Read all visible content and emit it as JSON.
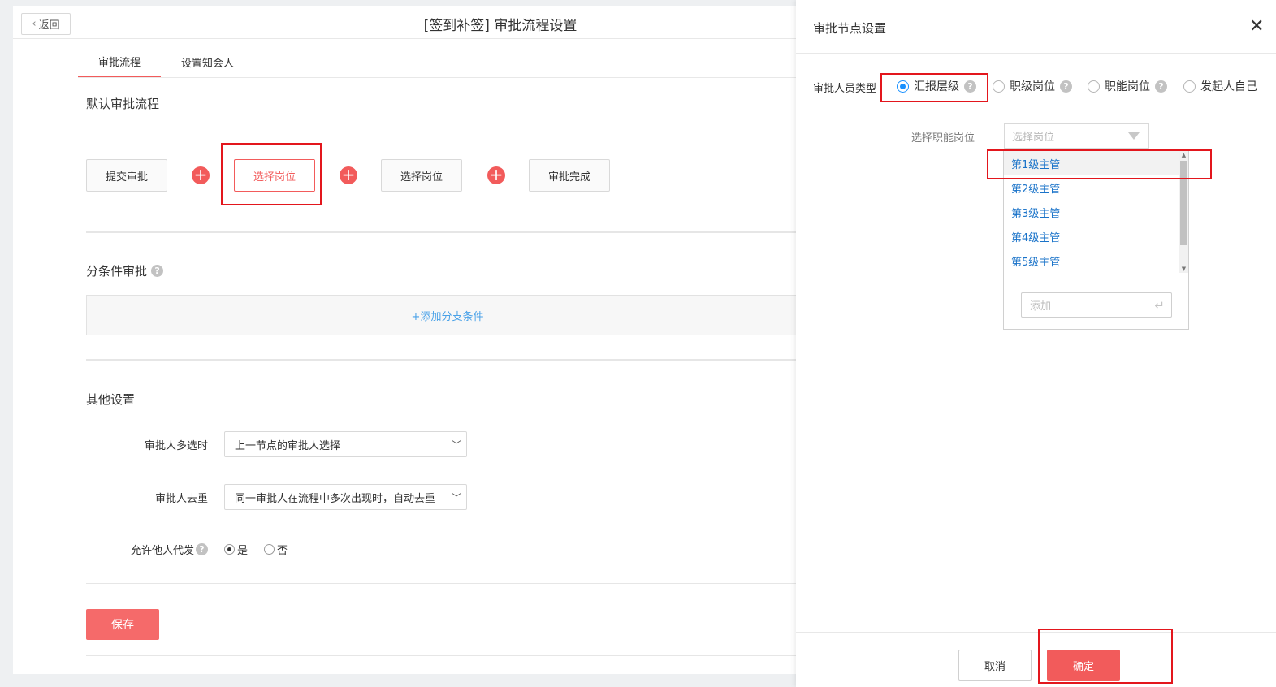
{
  "header": {
    "back_label": "返回",
    "title": "[签到补签] 审批流程设置"
  },
  "tabs": [
    {
      "label": "审批流程",
      "active": true
    },
    {
      "label": "设置知会人",
      "active": false
    }
  ],
  "default_flow": {
    "title": "默认审批流程",
    "nodes": [
      "提交审批",
      "选择岗位",
      "选择岗位",
      "审批完成"
    ],
    "add_icon": "plus-circle-icon"
  },
  "branch": {
    "title": "分条件审批",
    "help_icon": "?",
    "add_label": "+添加分支条件"
  },
  "other_settings": {
    "title": "其他设置",
    "multi_select": {
      "label": "审批人多选时",
      "value": "上一节点的审批人选择"
    },
    "dedupe": {
      "label": "审批人去重",
      "value": "同一审批人在流程中多次出现时，自动去重"
    },
    "allow_delegate": {
      "label": "允许他人代发",
      "help": "?",
      "options": [
        {
          "label": "是",
          "checked": true
        },
        {
          "label": "否",
          "checked": false
        }
      ]
    }
  },
  "save_label": "保存",
  "panel": {
    "title": "审批节点设置",
    "close_icon": "✕",
    "approver_type_label": "审批人员类型",
    "approver_types": [
      {
        "label": "汇报层级",
        "checked": true,
        "help": "?"
      },
      {
        "label": "职级岗位",
        "checked": false,
        "help": "?"
      },
      {
        "label": "职能岗位",
        "checked": false,
        "help": "?"
      },
      {
        "label": "发起人自己",
        "checked": false
      }
    ],
    "position_label": "选择职能岗位",
    "position_placeholder": "选择岗位",
    "dropdown_items": [
      "第1级主管",
      "第2级主管",
      "第3级主管",
      "第4级主管",
      "第5级主管"
    ],
    "add_placeholder": "添加",
    "cancel_label": "取消",
    "ok_label": "确定"
  },
  "colors": {
    "accent": "#f25b5b",
    "highlight_box": "#e3161d",
    "link_blue": "#1a73c9",
    "radio_blue": "#1890ff"
  }
}
